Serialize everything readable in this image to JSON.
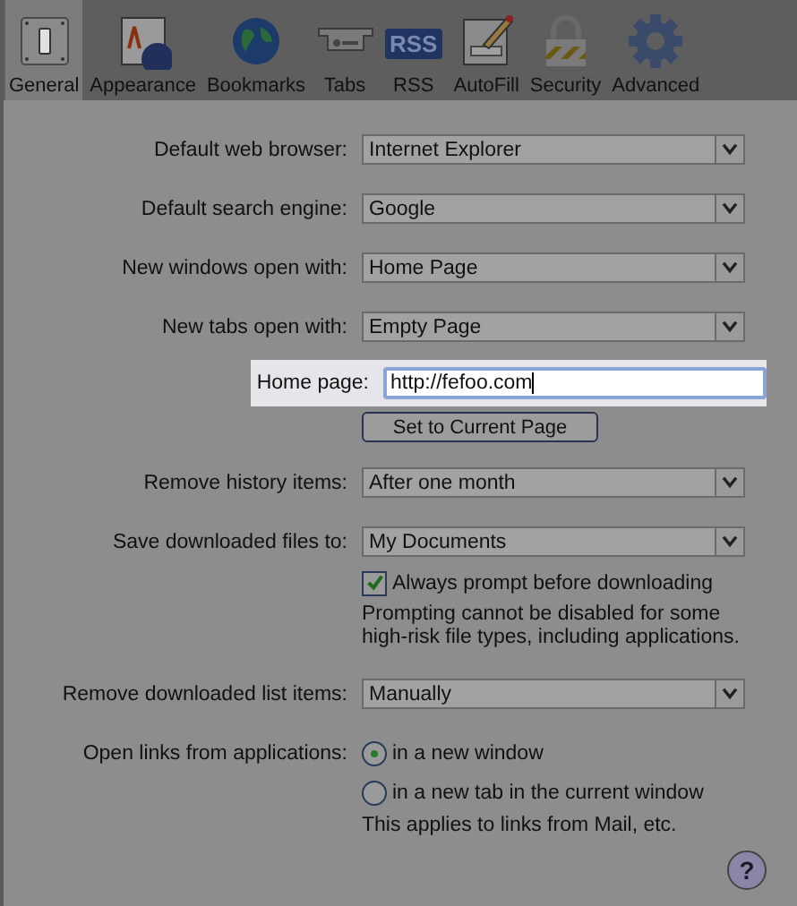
{
  "tabs": [
    {
      "label": "General",
      "kind": "general",
      "selected": true
    },
    {
      "label": "Appearance",
      "kind": "appearance",
      "selected": false
    },
    {
      "label": "Bookmarks",
      "kind": "bookmarks",
      "selected": false
    },
    {
      "label": "Tabs",
      "kind": "tabs",
      "selected": false
    },
    {
      "label": "RSS",
      "kind": "rss",
      "icon_text": "RSS",
      "selected": false
    },
    {
      "label": "AutoFill",
      "kind": "autofill",
      "selected": false
    },
    {
      "label": "Security",
      "kind": "security",
      "selected": false
    },
    {
      "label": "Advanced",
      "kind": "advanced",
      "selected": false
    }
  ],
  "rows": [
    {
      "kind": "select",
      "label": "Default web browser:",
      "value": "Internet Explorer"
    },
    {
      "kind": "select",
      "label": "Default search engine:",
      "value": "Google"
    },
    {
      "kind": "select",
      "label": "New windows open with:",
      "value": "Home Page"
    },
    {
      "kind": "select",
      "label": "New tabs open with:",
      "value": "Empty Page"
    },
    {
      "kind": "text",
      "label": "Home page:",
      "value": "http://fefoo.com",
      "highlighted": true
    },
    {
      "kind": "button",
      "label": "Set to Current Page"
    },
    {
      "kind": "select",
      "label": "Remove history items:",
      "value": "After one month"
    },
    {
      "kind": "select",
      "label": "Save downloaded files to:",
      "value": "My Documents"
    },
    {
      "kind": "checkbox",
      "label": "Always prompt before downloading",
      "checked": true
    },
    {
      "kind": "note",
      "text": "Prompting cannot be disabled for some high-risk file types, including applications."
    },
    {
      "kind": "select",
      "label": "Remove downloaded list items:",
      "value": "Manually"
    },
    {
      "kind": "radio",
      "label": "Open links from applications:",
      "option": "in a new window",
      "selected": true
    },
    {
      "kind": "radio",
      "option": "in a new tab in the current window",
      "selected": false
    },
    {
      "kind": "note",
      "text": "This applies to links from Mail, etc."
    }
  ],
  "help_button": "?"
}
